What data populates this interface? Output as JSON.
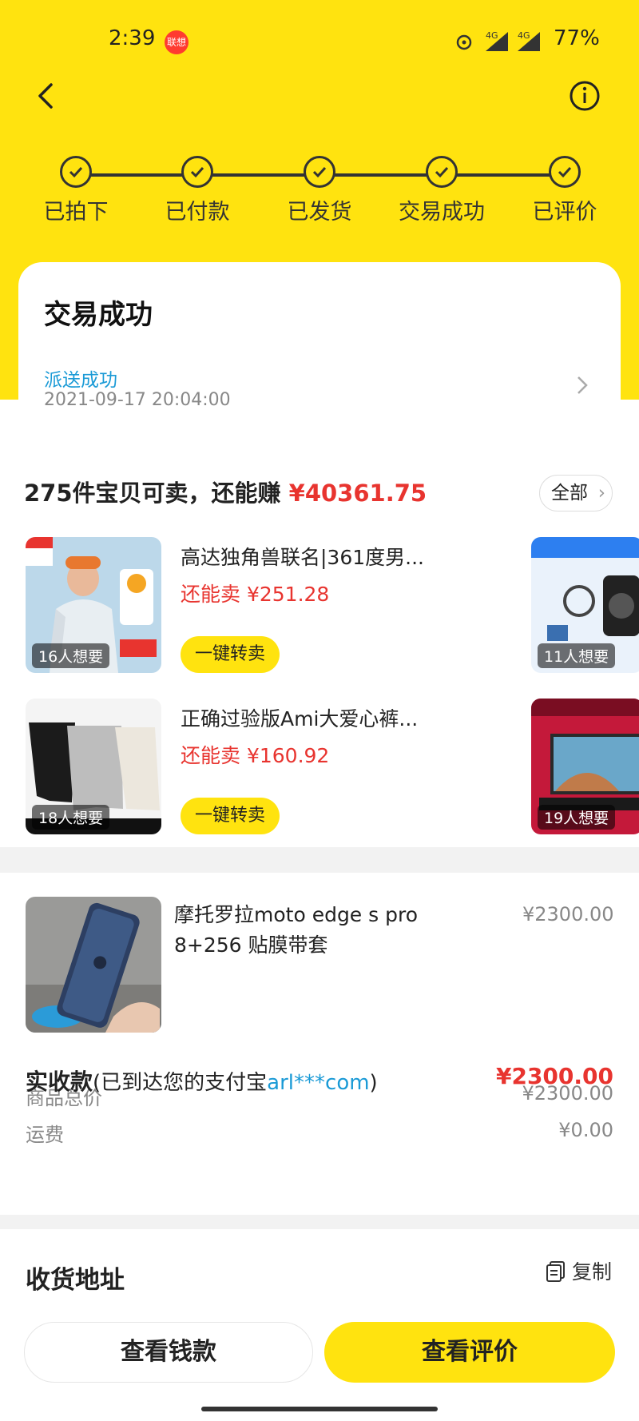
{
  "status_bar": {
    "time": "2:39",
    "badge": "联想",
    "network": "4G",
    "battery": "77%"
  },
  "progress": {
    "steps": [
      "已拍下",
      "已付款",
      "已发货",
      "交易成功",
      "已评价"
    ],
    "completed": 5
  },
  "status_card": {
    "title": "交易成功",
    "delivery_status": "派送成功",
    "delivery_time": "2021-09-17 20:04:00"
  },
  "resale": {
    "head_prefix": "275件宝贝可卖，还能赚 ",
    "head_amount": "¥40361.75",
    "all_label": "全部",
    "items": [
      {
        "title": "高达独角兽联名|361度男...",
        "price": "还能卖 ¥251.28",
        "want": "16人想要",
        "button": "一键转卖"
      },
      {
        "title": "正确过验版Ami大爱心裤...",
        "price": "还能卖 ¥160.92",
        "want": "18人想要",
        "button": "一键转卖"
      }
    ],
    "side_items": [
      {
        "want": "11人想要"
      },
      {
        "want": "19人想要"
      }
    ]
  },
  "order": {
    "product_title": "摩托罗拉moto edge s pro 8+256 贴膜带套",
    "product_price": "¥2300.00",
    "goods_total_label": "商品总价",
    "goods_total": "¥2300.00",
    "shipping_label": "运费",
    "shipping": "¥0.00",
    "received_label": "实收款",
    "received_note_prefix": "(已到达您的支付宝",
    "received_account": "arl***com",
    "received_note_suffix": ")",
    "received_amount": "¥2300.00"
  },
  "address": {
    "title": "收货地址",
    "copy_label": "复制"
  },
  "actions": {
    "view_money": "查看钱款",
    "view_review": "查看评价"
  },
  "colors": {
    "brand_yellow": "#ffe30f",
    "price_red": "#e8342f",
    "link_blue": "#1a9ad6"
  }
}
